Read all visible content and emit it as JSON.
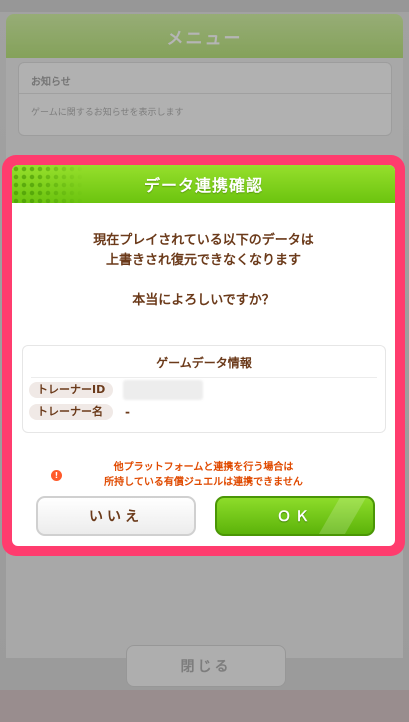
{
  "background": {
    "menu_title": "メニュー",
    "notice_title": "お知らせ",
    "notice_text": "ゲームに関するお知らせを表示します",
    "close_label": "閉じる"
  },
  "dialog": {
    "title": "データ連携確認",
    "message_line1": "現在プレイされている以下のデータは",
    "message_line2": "上書きされ復元できなくなります",
    "question": "本当によろしいですか？",
    "info": {
      "title": "ゲームデータ情報",
      "trainer_id_label": "トレーナーID",
      "trainer_name_label": "トレーナー名",
      "trainer_name_value": "-"
    },
    "warning_line1": "他プラットフォームと連携を行う場合は",
    "warning_line2": "所持している有償ジュエルは連携できません",
    "buttons": {
      "no_label": "いいえ",
      "ok_label": "ＯＫ"
    }
  },
  "colors": {
    "modal_border": "#ff3c6e",
    "header_green": "#6cc40f",
    "text_brown": "#6b3a1a",
    "warning_orange": "#e04a00"
  }
}
